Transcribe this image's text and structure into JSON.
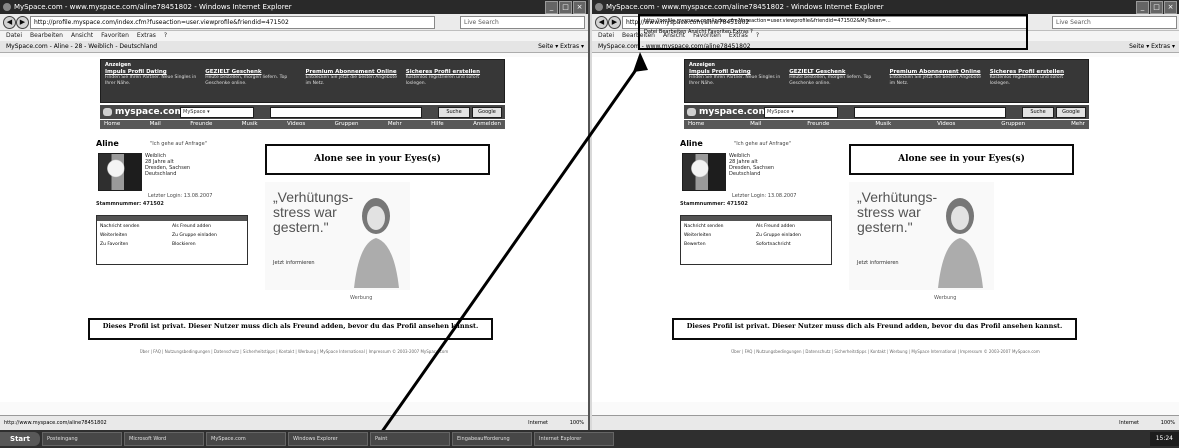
{
  "left": {
    "window_title": "MySpace.com - www.myspace.com/aline78451802 - Windows Internet Explorer",
    "url": "http://profile.myspace.com/index.cfm?fuseaction=user.viewprofile&friendid=471502",
    "search_placeholder": "Live Search",
    "menus": [
      "Datei",
      "Bearbeiten",
      "Ansicht",
      "Favoriten",
      "Extras",
      "?"
    ],
    "fav_text": "MySpace.com - Aline - 28 - Weiblich - Deutschland",
    "tools_text": "Seite ▾  Extras ▾",
    "status_url": "http://www.myspace.com/aline78451802",
    "status_zone": "Internet",
    "status_zoom": "100%"
  },
  "right": {
    "window_title": "MySpace.com - www.myspace.com/aline78451802 - Windows Internet Explorer",
    "url": "http://www.myspace.com/aline78451802",
    "search_placeholder": "Live Search",
    "menus": [
      "Datei",
      "Bearbeiten",
      "Ansicht",
      "Favoriten",
      "Extras",
      "?"
    ],
    "fav_text": "MySpace.com - www.myspace.com/aline78451802",
    "tools_text": "Seite ▾  Extras ▾",
    "status_zone": "Internet",
    "status_zoom": "100%",
    "highlight_lines": [
      "http://profile.myspace.com/index.cfm?fuseaction=user.viewprofile&friendid=471502&MyToken=...",
      "Datei  Bearbeiten  Ansicht  Favoriten  Extras  ?"
    ]
  },
  "page": {
    "ad_label": "Anzeigen",
    "ads": [
      {
        "title": "Impuls Profil Dating",
        "text": "Finden Sie Ihren Partner. Neue Singles in Ihrer Nähe."
      },
      {
        "title": "GEZIELT Geschenk",
        "text": "Heute bestellen, morgen liefern. Top Geschenke online."
      },
      {
        "title": "Premium Abonnement Online",
        "text": "Entdecken Sie jetzt die besten Angebote im Netz."
      },
      {
        "title": "Sicheres Profil erstellen",
        "text": "Kostenlos registrieren und sofort loslegen."
      }
    ],
    "logo": "myspace.com",
    "search_select": "MySpace ▾",
    "search_btn": "Suche",
    "google": "Google",
    "nav": [
      "Home",
      "Mail",
      "Freunde",
      "Musik",
      "Videos",
      "Gruppen",
      "Mehr",
      "Hilfe",
      "Anmelden"
    ],
    "profile_name": "Aline",
    "online_text": "\"Ich gehe auf Anfrage\"",
    "info_lines": [
      "Weiblich",
      "28 Jahre alt",
      "Dresden, Sachsen",
      "Deutschland"
    ],
    "last_login": "Letzter Login: 13.08.2007",
    "stamm": "Stammnummer: 471502",
    "actions": [
      "Nachricht senden",
      "Als Freund adden",
      "Weiterleiten",
      "Zu Gruppe einladen",
      "Zu Favoriten",
      "Blockieren",
      "Bewerten",
      "Sofortnachricht"
    ],
    "quote": "Alone see in your Eyes(s)",
    "ad_text": "„Verhütungs-\nstress war\ngestern.\"",
    "ad_jetzt": "Jetzt informieren",
    "ad_werbung": "Werbung",
    "private": "Dieses Profil ist privat. Dieser Nutzer muss dich als Freund adden, bevor du das Profil ansehen kannst.",
    "footer": "Über | FAQ | Nutzungsbedingungen | Datenschutz | Sicherheitstipps | Kontakt | Werbung | MySpace International | Impressum © 2003-2007 MySpace.com"
  },
  "taskbar": {
    "start": "Start",
    "tasks": [
      "Posteingang",
      "Microsoft Word",
      "MySpace.com",
      "Windows Explorer",
      "Paint",
      "Eingabeaufforderung",
      "Internet Explorer"
    ],
    "clock": "15:24"
  }
}
